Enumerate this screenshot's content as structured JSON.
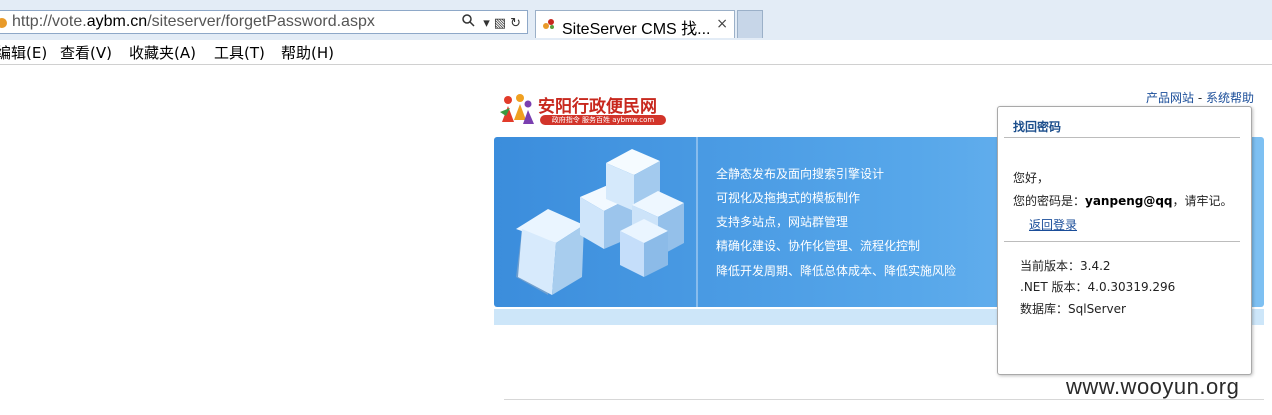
{
  "browser": {
    "url_prefix": "http://vote.",
    "url_domain": "aybm.cn",
    "url_suffix": "/siteserver/forgetPassword.aspx",
    "tab_title": "SiteServer CMS 找...",
    "tab_close": "×"
  },
  "menu": {
    "edit": "编辑(E)",
    "view": "查看(V)",
    "favorites": "收藏夹(A)",
    "tools": "工具(T)",
    "help": "帮助(H)"
  },
  "logo": {
    "name": "安阳行政便民网",
    "tagline": "政府指令 服务百姓 aybmw.com"
  },
  "top_links": {
    "product_site": "产品网站",
    "separator": " - ",
    "system_help": "系统帮助"
  },
  "banner": {
    "features": [
      "全静态发布及面向搜索引擎设计",
      "可视化及拖拽式的模板制作",
      "支持多站点，网站群管理",
      "精确化建设、协作化管理、流程化控制",
      "降低开发周期、降低总体成本、降低实施风险"
    ]
  },
  "panel": {
    "title": "找回密码",
    "greeting": "您好，",
    "password_label": "您的密码是：",
    "password_value": "yanpeng@qq",
    "password_note": "，请牢记。",
    "back_login": "返回登录",
    "version": "当前版本：3.4.2",
    "net_version": ".NET 版本：4.0.30319.296",
    "database": "数据库：SqlServer"
  },
  "watermark": "www.wooyun.org",
  "colors": {
    "banner": "#4a9be3",
    "link": "#1a4d99",
    "logo_red": "#c8281e"
  }
}
